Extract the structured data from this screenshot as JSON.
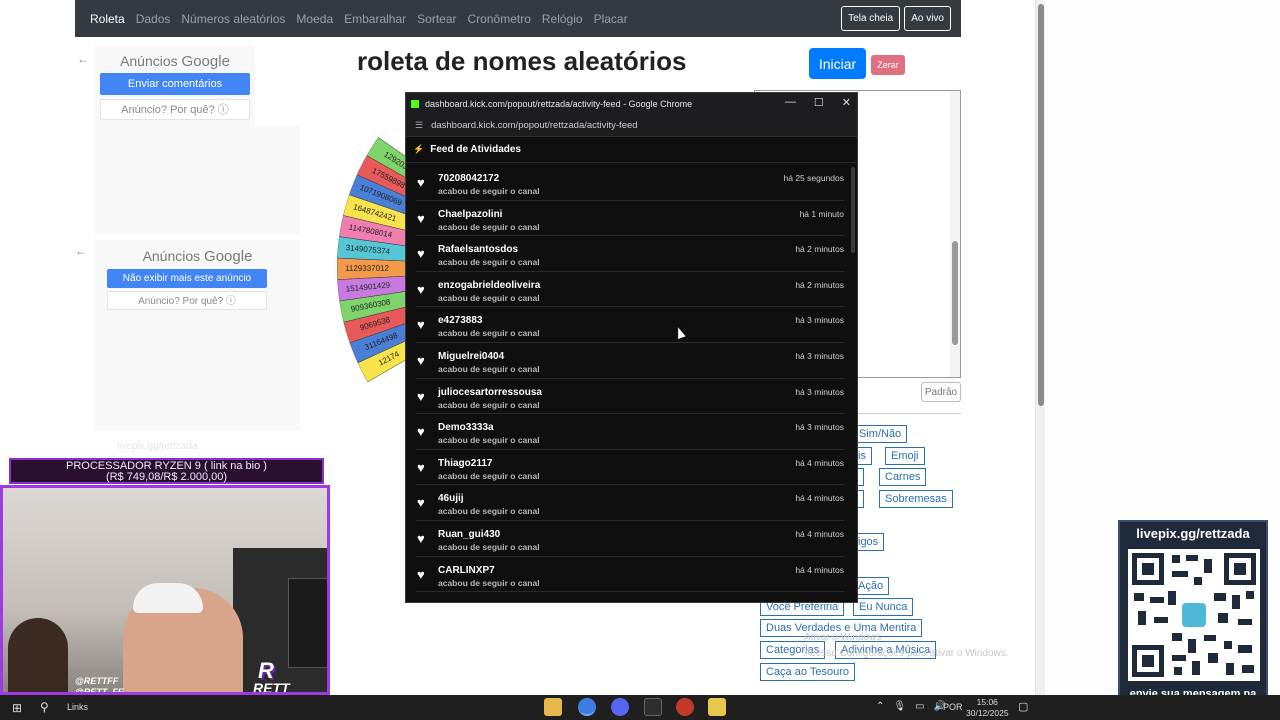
{
  "site": {
    "nav_items": [
      "Roleta",
      "Dados",
      "Números aleatórios",
      "Moeda",
      "Embaralhar",
      "Sortear",
      "Cronômetro",
      "Relógio",
      "Placar"
    ],
    "fullscreen_label": "Tela cheia",
    "live_label": "Ao vivo",
    "page_title": "roleta de nomes aleatórios",
    "start_label": "Iniciar",
    "reset_label": "Zerar",
    "default_label": "Padrão",
    "wheel_numbers": [
      "12174",
      "31164498",
      "9069538",
      "909360308",
      "1514901429",
      "1129337012",
      "3149075374",
      "1147808014",
      "1648742421",
      "1071908069",
      "17559898",
      "1292036"
    ],
    "tags": [
      "Sim/Não",
      "is",
      "Emoji",
      "Carnes",
      "Sobremesas",
      "igos",
      "Ação",
      "Você Preferiria",
      "Eu Nunca",
      "Duas Verdades e Uma Mentira",
      "Categorias",
      "Adivinhe a Música",
      "Caça ao Tesouro"
    ],
    "activate_text": "Ativar o Windows",
    "activate_sub": "Acesse Configurações para ativar o Windows."
  },
  "ads": {
    "ad1_title_prefix": "Anúncios",
    "ad1_title_brand": "Google",
    "ad1_primary": "Enviar comentários",
    "ad1_secondary": "Anúncio? Por quê? ⓘ",
    "ad2_title_prefix": "Anúncios",
    "ad2_title_brand": "Google",
    "ad2_primary": "Não exibir mais este anúncio",
    "ad2_secondary": "Anúncio? Por quê? ⓘ"
  },
  "stream": {
    "livepix_watermark": "livepix.gg/rettzada",
    "promo_line1": "PROCESSADOR RYZEN 9 ( link na bio )",
    "promo_line2": "(R$ 749,08/R$ 2.000,00)",
    "handle1": "@RETTFF",
    "handle2": "@RETT_FE",
    "logo_r": "R",
    "logo_text": "RETT",
    "qr_title": "livepix.gg/rettzada",
    "qr_caption": "envie sua mensagem na live via pix!"
  },
  "popup": {
    "window_title": "dashboard.kick.com/popout/rettzada/activity-feed - Google Chrome",
    "url": "dashboard.kick.com/popout/rettzada/activity-feed",
    "minimize": "—",
    "maximize": "☐",
    "close": "✕",
    "feed_title": "Feed de Atividades",
    "action_text": "acabou de seguir o canal",
    "items": [
      {
        "user": "70208042172",
        "time": "há 25 segundos"
      },
      {
        "user": "Chaelpazolini",
        "time": "há 1 minuto"
      },
      {
        "user": "Rafaelsantosdos",
        "time": "há 2 minutos"
      },
      {
        "user": "enzogabrieldeoliveira",
        "time": "há 2 minutos"
      },
      {
        "user": "e4273883",
        "time": "há 3 minutos"
      },
      {
        "user": "Miguelrei0404",
        "time": "há 3 minutos"
      },
      {
        "user": "juliocesartorressousa",
        "time": "há 3 minutos"
      },
      {
        "user": "Demo3333a",
        "time": "há 3 minutos"
      },
      {
        "user": "Thiago2117",
        "time": "há 4 minutos"
      },
      {
        "user": "46ujij",
        "time": "há 4 minutos"
      },
      {
        "user": "Ruan_gui430",
        "time": "há 4 minutos"
      },
      {
        "user": "CARLINXP7",
        "time": "há 4 minutos"
      }
    ]
  },
  "taskbar": {
    "links_label": "Links",
    "lang": "POR",
    "time": "15:06",
    "date": "30/12/2025"
  },
  "colors": {
    "accent": "#007bff",
    "kick_green": "#53fc18",
    "popup_bg": "#0f0f10"
  }
}
